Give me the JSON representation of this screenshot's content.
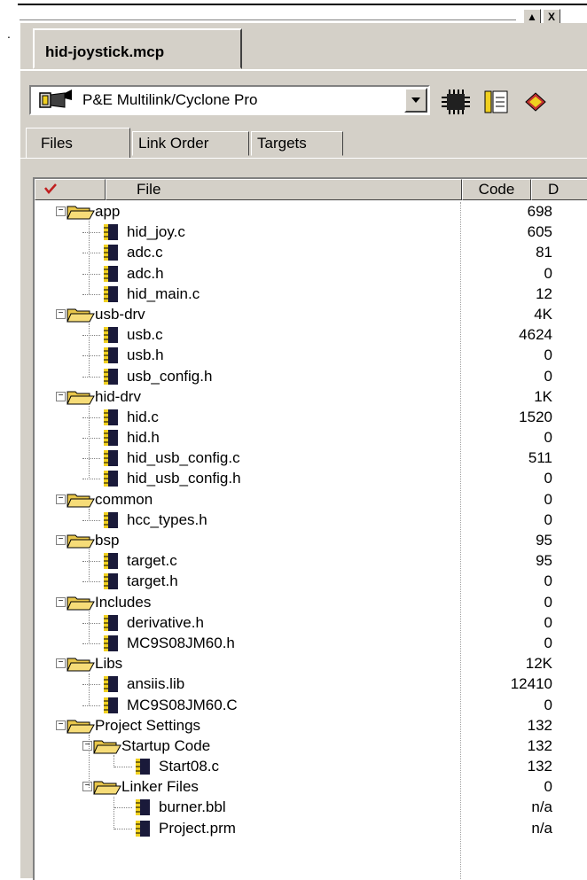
{
  "window": {
    "minimize_label": "▲",
    "close_label": "X"
  },
  "doc_tab": {
    "label": "hid-joystick.mcp"
  },
  "toolbar": {
    "target": "P&E Multilink/Cyclone Pro",
    "icons": [
      "target-icon",
      "chip-icon",
      "settings-icon",
      "debug-icon"
    ]
  },
  "view_tabs": [
    {
      "label": "Files",
      "active": true
    },
    {
      "label": "Link Order",
      "active": false
    },
    {
      "label": "Targets",
      "active": false
    }
  ],
  "columns": {
    "file": "File",
    "code": "Code",
    "data": "D"
  },
  "tree": [
    {
      "name": "app",
      "type": "folder",
      "depth": 0,
      "expanded": true,
      "code": "698"
    },
    {
      "name": "hid_joy.c",
      "type": "file",
      "depth": 1,
      "code": "605"
    },
    {
      "name": "adc.c",
      "type": "file",
      "depth": 1,
      "code": "81"
    },
    {
      "name": "adc.h",
      "type": "file",
      "depth": 1,
      "code": "0"
    },
    {
      "name": "hid_main.c",
      "type": "file",
      "depth": 1,
      "code": "12"
    },
    {
      "name": "usb-drv",
      "type": "folder",
      "depth": 0,
      "expanded": true,
      "code": "4K"
    },
    {
      "name": "usb.c",
      "type": "file",
      "depth": 1,
      "code": "4624"
    },
    {
      "name": "usb.h",
      "type": "file",
      "depth": 1,
      "code": "0"
    },
    {
      "name": "usb_config.h",
      "type": "file",
      "depth": 1,
      "code": "0"
    },
    {
      "name": "hid-drv",
      "type": "folder",
      "depth": 0,
      "expanded": true,
      "code": "1K"
    },
    {
      "name": "hid.c",
      "type": "file",
      "depth": 1,
      "code": "1520"
    },
    {
      "name": "hid.h",
      "type": "file",
      "depth": 1,
      "code": "0"
    },
    {
      "name": "hid_usb_config.c",
      "type": "file",
      "depth": 1,
      "code": "511"
    },
    {
      "name": "hid_usb_config.h",
      "type": "file",
      "depth": 1,
      "code": "0"
    },
    {
      "name": "common",
      "type": "folder",
      "depth": 0,
      "expanded": true,
      "code": "0"
    },
    {
      "name": "hcc_types.h",
      "type": "file",
      "depth": 1,
      "code": "0"
    },
    {
      "name": "bsp",
      "type": "folder",
      "depth": 0,
      "expanded": true,
      "code": "95"
    },
    {
      "name": "target.c",
      "type": "file",
      "depth": 1,
      "code": "95"
    },
    {
      "name": "target.h",
      "type": "file",
      "depth": 1,
      "code": "0"
    },
    {
      "name": "Includes",
      "type": "folder",
      "depth": 0,
      "expanded": true,
      "code": "0"
    },
    {
      "name": "derivative.h",
      "type": "file",
      "depth": 1,
      "code": "0"
    },
    {
      "name": "MC9S08JM60.h",
      "type": "file",
      "depth": 1,
      "code": "0"
    },
    {
      "name": "Libs",
      "type": "folder",
      "depth": 0,
      "expanded": true,
      "code": "12K"
    },
    {
      "name": "ansiis.lib",
      "type": "file",
      "depth": 1,
      "code": "12410"
    },
    {
      "name": "MC9S08JM60.C",
      "type": "file",
      "depth": 1,
      "code": "0"
    },
    {
      "name": "Project Settings",
      "type": "folder",
      "depth": 0,
      "expanded": true,
      "code": "132"
    },
    {
      "name": "Startup Code",
      "type": "folder",
      "depth": 1,
      "expanded": true,
      "code": "132"
    },
    {
      "name": "Start08.c",
      "type": "file",
      "depth": 2,
      "code": "132"
    },
    {
      "name": "Linker Files",
      "type": "folder",
      "depth": 1,
      "expanded": true,
      "code": "0"
    },
    {
      "name": "burner.bbl",
      "type": "file",
      "depth": 2,
      "code": "n/a"
    },
    {
      "name": "Project.prm",
      "type": "file",
      "depth": 2,
      "code": "n/a"
    }
  ],
  "colors": {
    "face": "#d4d0c8",
    "folder": "#e8c64a",
    "file_dark": "#1a1a3a",
    "file_yellow": "#f0d020"
  }
}
